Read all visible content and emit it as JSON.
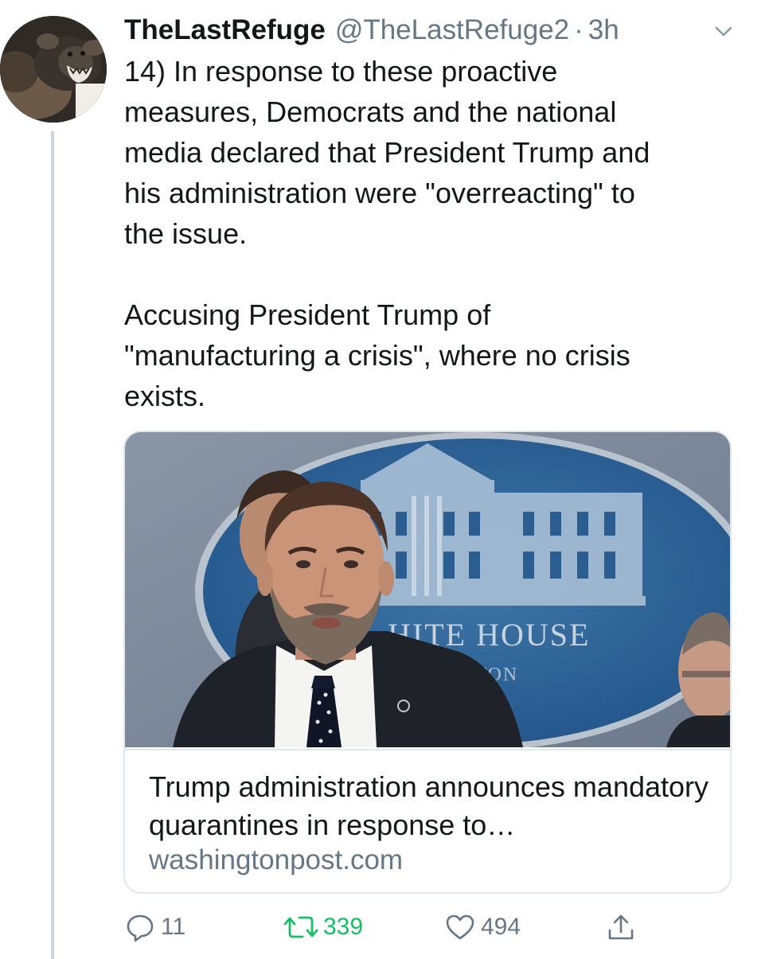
{
  "tweet": {
    "display_name": "TheLastRefuge",
    "handle": "@TheLastRefuge2",
    "separator": "·",
    "time": "3h",
    "text": "14)  In response to these proactive\nmeasures, Democrats and the national\nmedia declared that President Trump and\nhis administration were \"overreacting\" to\nthe issue.\n\nAccusing President Trump of\n\"manufacturing a crisis\", where no crisis\nexists."
  },
  "card": {
    "image_sign_text": "HITE HOUSE",
    "image_sign_subtext": "GTON",
    "title": "Trump administration announces mandatory quarantines in response to…",
    "domain": "washingtonpost.com"
  },
  "actions": {
    "reply_count": "11",
    "retweet_count": "339",
    "like_count": "494"
  },
  "colors": {
    "text_primary": "#14171a",
    "text_secondary": "#657786",
    "border": "#e1e8ed",
    "retweet_active": "#17bf63",
    "thread_line": "#ccd6dd"
  },
  "icons": {
    "avatar": "wolverine-avatar",
    "caret": "chevron-down-icon",
    "reply": "reply-icon",
    "retweet": "retweet-icon",
    "like": "heart-icon",
    "share": "share-icon"
  }
}
